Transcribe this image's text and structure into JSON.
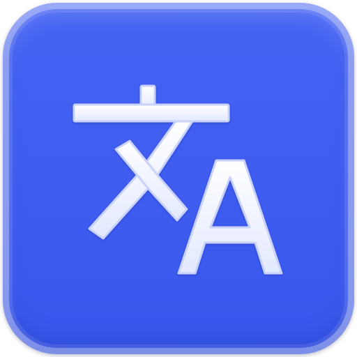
{
  "icon": {
    "glyph_primary": "文",
    "glyph_secondary": "A",
    "background_color": "#4262f2",
    "glyph_fill_color": "#f1f4ff",
    "glyph_outline_color": "#c7d0fb",
    "icon_name": "translate-icon"
  }
}
